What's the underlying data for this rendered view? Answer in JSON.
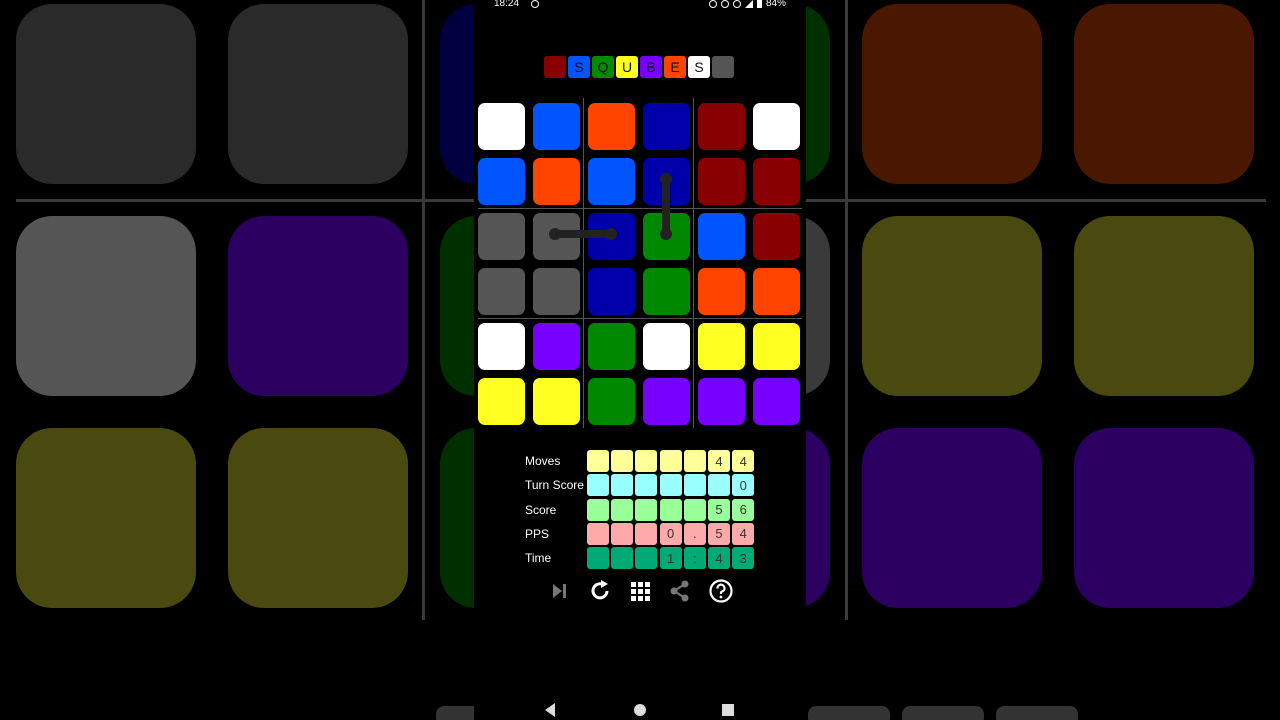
{
  "status_bar": {
    "time": "18:24",
    "battery": "84%"
  },
  "title_letters": [
    {
      "ch": "",
      "bg": "#8a0000",
      "fg": "#fff"
    },
    {
      "ch": "S",
      "bg": "#0055ff",
      "fg": "#111"
    },
    {
      "ch": "Q",
      "bg": "#008a00",
      "fg": "#111"
    },
    {
      "ch": "U",
      "bg": "#ffff22",
      "fg": "#111"
    },
    {
      "ch": "B",
      "bg": "#7700ff",
      "fg": "#111"
    },
    {
      "ch": "E",
      "bg": "#ff4400",
      "fg": "#111"
    },
    {
      "ch": "S",
      "bg": "#ffffff",
      "fg": "#111"
    },
    {
      "ch": "",
      "bg": "#555555",
      "fg": "#fff"
    }
  ],
  "colors": {
    "white": "#ffffff",
    "blue": "#0055ff",
    "orange": "#ff4400",
    "navy": "#0000aa",
    "maroon": "#880000",
    "gray": "#555555",
    "green": "#008800",
    "purple": "#7700ff",
    "yellow": "#ffff22"
  },
  "board": [
    [
      "white",
      "blue",
      "orange",
      "navy",
      "maroon",
      "white"
    ],
    [
      "blue",
      "orange",
      "blue",
      "navy",
      "maroon",
      "maroon"
    ],
    [
      "gray",
      "gray",
      "navy",
      "green",
      "blue",
      "maroon"
    ],
    [
      "gray",
      "gray",
      "navy",
      "green",
      "orange",
      "orange"
    ],
    [
      "white",
      "purple",
      "green",
      "white",
      "yellow",
      "yellow"
    ],
    [
      "yellow",
      "yellow",
      "green",
      "purple",
      "purple",
      "purple"
    ]
  ],
  "stats": [
    {
      "label": "Moves",
      "cells": [
        "",
        "",
        "",
        "",
        "",
        "4",
        "4"
      ],
      "bg": "#ffff99",
      "dim": "#ffff99",
      "fg": "#333"
    },
    {
      "label": "Turn Score",
      "cells": [
        "",
        "",
        "",
        "",
        "",
        "",
        "0"
      ],
      "bg": "#99ffff",
      "dim": "#99ffff",
      "fg": "#333"
    },
    {
      "label": "Score",
      "cells": [
        "",
        "",
        "",
        "",
        "",
        "5",
        "6"
      ],
      "bg": "#99ff99",
      "dim": "#99ff99",
      "fg": "#333"
    },
    {
      "label": "PPS",
      "cells": [
        "",
        "",
        "",
        "0",
        ".",
        "5",
        "4"
      ],
      "bg": "#ffaaaa",
      "dim": "#ffaaaa",
      "fg": "#333"
    },
    {
      "label": "Time",
      "cells": [
        "",
        "",
        "",
        "1",
        ":",
        "4",
        "3"
      ],
      "bg": "#00aa77",
      "dim": "#00aa77",
      "fg": "#333"
    }
  ],
  "toolbar": [
    "skip-icon",
    "restart-icon",
    "grid-icon",
    "share-icon",
    "help-icon"
  ]
}
